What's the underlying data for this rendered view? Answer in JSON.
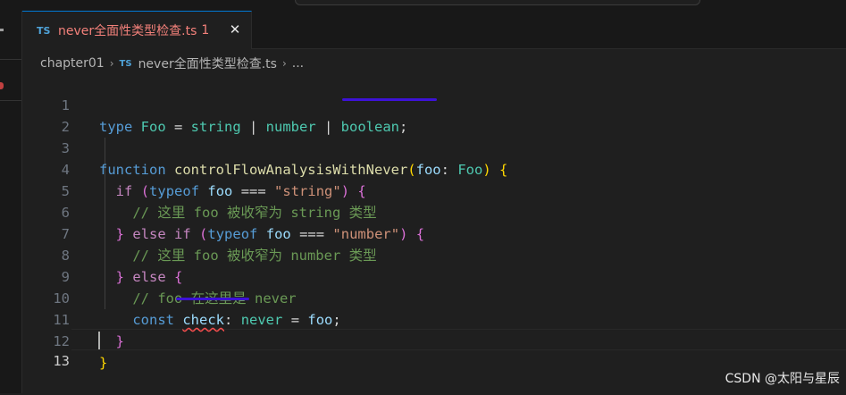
{
  "tab": {
    "lang_badge": "TS",
    "filename": "never全面性类型检查.ts",
    "problem_count": "1",
    "close_glyph": "✕"
  },
  "breadcrumb": {
    "folder": "chapter01",
    "sep": "›",
    "lang_badge": "TS",
    "file": "never全面性类型检查.ts",
    "more": "..."
  },
  "gutter": [
    "1",
    "2",
    "3",
    "4",
    "5",
    "6",
    "7",
    "8",
    "9",
    "10",
    "11",
    "12",
    "13"
  ],
  "code": {
    "l1": {
      "type": "type",
      "name": "Foo",
      "eq": " = ",
      "t1": "string",
      "bar1": " | ",
      "t2": "number",
      "bar2": " | ",
      "t3": "boolean",
      "semi": ";"
    },
    "l3": {
      "function": "function",
      "fname": "controlFlowAnalysisWithNever",
      "open": "(",
      "param": "foo",
      "colon": ": ",
      "ptype": "Foo",
      "close": ")",
      "brace": "{"
    },
    "l4": {
      "if": "if",
      "open": "(",
      "typeof": "typeof",
      "var": "foo",
      "op": " === ",
      "str": "\"string\"",
      "close": ")",
      "brace": "{"
    },
    "l5": {
      "comment": "// 这里 foo 被收窄为 string 类型"
    },
    "l6": {
      "close": "}",
      "else": "else",
      "if": "if",
      "open": "(",
      "typeof": "typeof",
      "var": "foo",
      "op": " === ",
      "str": "\"number\"",
      "rparen": ")",
      "brace": "{"
    },
    "l7": {
      "comment": "// 这里 foo 被收窄为 number 类型"
    },
    "l8": {
      "close": "}",
      "else": "else",
      "brace": "{"
    },
    "l9": {
      "comment": "// foo 在这里是 never"
    },
    "l10": {
      "const": "const",
      "name": "check",
      "colon": ": ",
      "type": "never",
      "eq": " = ",
      "var": "foo",
      "semi": ";"
    },
    "l11": {
      "brace": "}"
    },
    "l12": {
      "brace": "}"
    }
  },
  "watermark": "CSDN @太阳与星辰",
  "colors": {
    "accent": "#0078d4",
    "error_tab": "#f2807a",
    "annotation_underline": "#3d12d6",
    "squiggle": "#f14c4c"
  }
}
